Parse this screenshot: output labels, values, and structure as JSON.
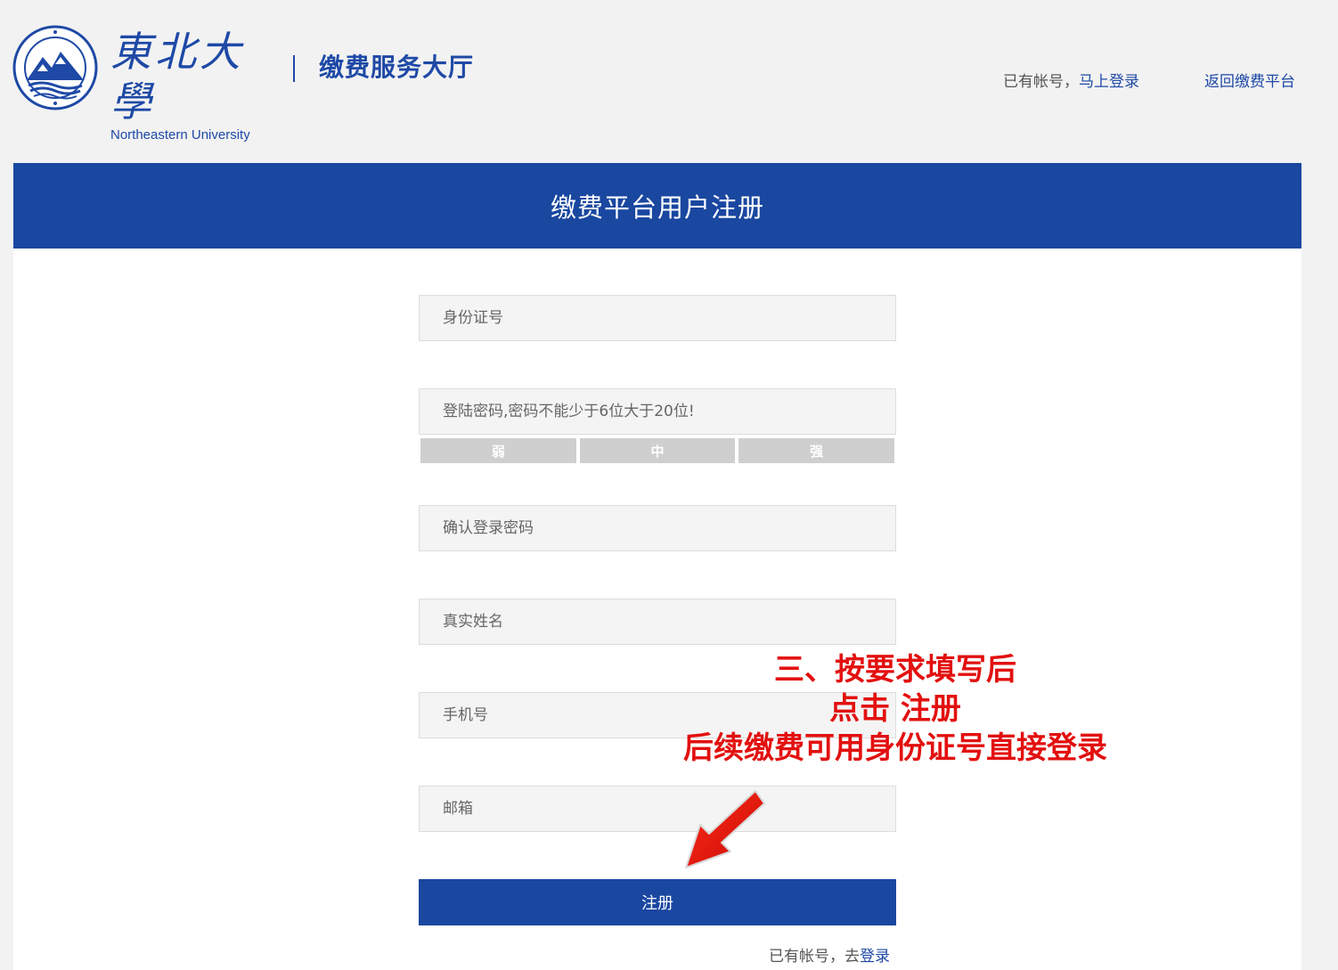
{
  "header": {
    "logo_cn": "東北大學",
    "logo_en": "Northeastern University",
    "hall_title": "缴费服务大厅",
    "have_account_text": "已有帐号，",
    "login_now_link": "马上登录",
    "back_link": "返回缴费平台"
  },
  "panel": {
    "title": "缴费平台用户注册"
  },
  "form": {
    "id_number_placeholder": "身份证号",
    "password_placeholder": "登陆密码,密码不能少于6位大于20位!",
    "strength": [
      "弱",
      "中",
      "强"
    ],
    "confirm_password_placeholder": "确认登录密码",
    "real_name_placeholder": "真实姓名",
    "phone_placeholder": "手机号",
    "email_placeholder": "邮箱",
    "register_button": "注册",
    "bottom_have_account": "已有帐号，去",
    "bottom_login_link": "登录"
  },
  "annotation": {
    "line1": "三、按要求填写后",
    "line2": "点击 注册",
    "line3": "后续缴费可用身份证号直接登录"
  },
  "colors": {
    "brand_blue": "#1a47a0",
    "annotation_red": "#e2100f"
  }
}
